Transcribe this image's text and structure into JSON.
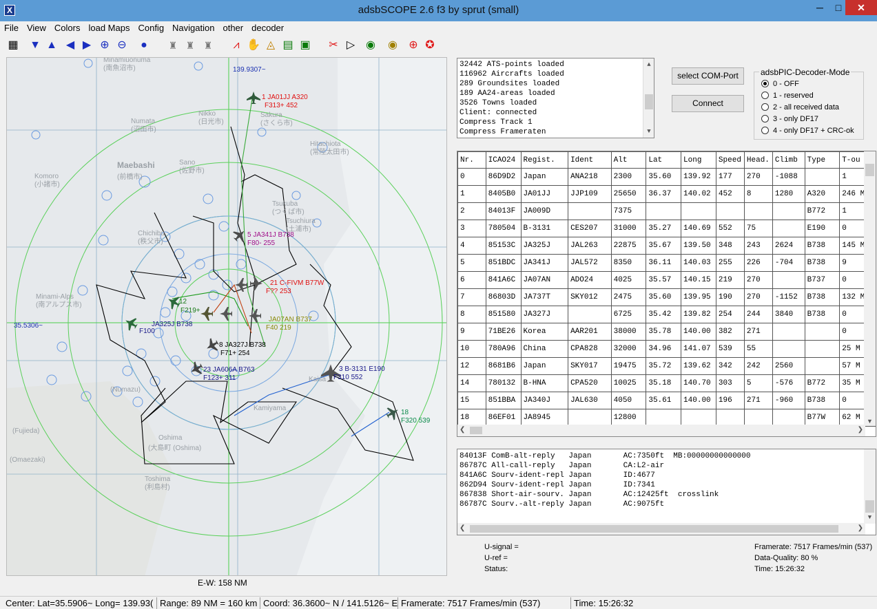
{
  "window": {
    "title": "adsbSCOPE 2.6 f3 by sprut  (small)",
    "min": "─",
    "max": "□",
    "close": "✕",
    "app_icon": "X"
  },
  "menu": [
    "File",
    "View",
    "Colors",
    "load Maps",
    "Config",
    "Navigation",
    "other",
    "decoder"
  ],
  "toolbar_icons": [
    "table-icon",
    "arrow-down-icon",
    "arrow-up-icon",
    "arrow-left-icon",
    "arrow-right-icon",
    "zoom-in-icon",
    "zoom-out-icon",
    "globe-icon",
    "tower-icon",
    "tower-icon",
    "tower-icon",
    "graph-icon",
    "hand-icon",
    "radar-icon",
    "map-icon",
    "monitor-icon",
    "tools-icon",
    "play-icon",
    "record-icon",
    "record-icon",
    "target-icon",
    "lifebuoy-icon"
  ],
  "map": {
    "lon_label": "139.9307~",
    "lat_label": "35.5306~",
    "ew_label": "E-W: 158 NM",
    "aircraft": [
      {
        "label1": "1  JA01JJ  A320",
        "label2": "F313+ 452",
        "color": "#e01010"
      },
      {
        "label1": "5  JA341J  B738",
        "label2": "F80- 255",
        "color": "#a0108a"
      },
      {
        "label1": "21  C-FIVM  B77W",
        "label2": "F??  253",
        "color": "#e01010"
      },
      {
        "label1": "12",
        "label2": "F219+",
        "color": "#1a7a1a"
      },
      {
        "label1": "JA325J  B738",
        "label2": "F100",
        "color": "#1a1a8a"
      },
      {
        "label1": "8  JA327J  B738",
        "label2": "F71+ 254",
        "color": "#000000"
      },
      {
        "label1": "23  JA606A  B763",
        "label2": "F123+ 311",
        "color": "#1a1a8a"
      },
      {
        "label1": "3  B-3131  E190",
        "label2": "F310  552",
        "color": "#1a1a8a"
      },
      {
        "label1": "18",
        "label2": "F320  539",
        "color": "#0a8a4a"
      },
      {
        "label1": "JA07AN  B737",
        "label2": "F40  219",
        "color": "#8a8a0a"
      }
    ],
    "places": [
      {
        "en": "Minamiuonuma",
        "jp": "(南魚沼市)"
      },
      {
        "en": "Numata",
        "jp": "(沼田市)"
      },
      {
        "en": "Maebashi",
        "jp": "(前橋市)"
      },
      {
        "en": "Nikko",
        "jp": "(日光市)"
      },
      {
        "en": "Sakura",
        "jp": "(さくら市)"
      },
      {
        "en": "Hitachiota",
        "jp": "(常陸太田市)"
      },
      {
        "en": "Komoro",
        "jp": "(小諸市)"
      },
      {
        "en": "Sano",
        "jp": "(佐野市)"
      },
      {
        "en": "Tsukuba",
        "jp": "(つくば市)"
      },
      {
        "en": "Chichibu",
        "jp": "(秩父市)"
      },
      {
        "en": "Tsuchiura",
        "jp": "(土浦市)"
      },
      {
        "en": "Minami-Alps",
        "jp": "(南アルプス市)"
      },
      {
        "en": "Numazu",
        "jp": "(Numazu)"
      },
      {
        "en": "Fujieda",
        "jp": "(Fujieda)"
      },
      {
        "en": "Omaezaki",
        "jp": "(Omaezaki)"
      },
      {
        "en": "Oshima",
        "jp": "(大島町 (Oshima)"
      },
      {
        "en": "Toshima",
        "jp": "(利島村)"
      },
      {
        "en": "Kaisa",
        "jp": ""
      },
      {
        "en": "Kamiyama",
        "jp": ""
      }
    ]
  },
  "log": {
    "lines": [
      "32442 ATS-points loaded",
      "116962 Aircrafts loaded",
      "289 Groundsites loaded",
      "189 AA24-areas loaded",
      "3526 Towns loaded",
      "Client: connected",
      "Compress Track 1",
      "Compress Frameraten"
    ]
  },
  "buttons": {
    "com_port": "select COM-Port",
    "connect": "Connect"
  },
  "decoder_mode": {
    "title": "adsbPIC-Decoder-Mode",
    "options": [
      "0 - OFF",
      "1 - reserved",
      "2 - all received data",
      "3 - only DF17",
      "4 - only DF17 + CRC-ok"
    ],
    "selected": 0
  },
  "table": {
    "columns": [
      "Nr.",
      "ICAO24",
      "Regist.",
      "Ident",
      "Alt",
      "Lat",
      "Long",
      "Speed",
      "Head.",
      "Climb",
      "Type",
      "T-ou"
    ],
    "rows": [
      [
        "0",
        "86D9D2",
        "Japan",
        "ANA218",
        "2300",
        "35.60",
        "139.92",
        "177",
        "270",
        "-1088",
        "",
        "1"
      ],
      [
        "1",
        "8405B0",
        "JA01JJ",
        "JJP109",
        "25650",
        "36.37",
        "140.02",
        "452",
        "8",
        "1280",
        "A320",
        "246 M"
      ],
      [
        "2",
        "84013F",
        "JA009D",
        "",
        "7375",
        "",
        "",
        "",
        "",
        "",
        "B772",
        "1"
      ],
      [
        "3",
        "780504",
        "B-3131",
        "CES207",
        "31000",
        "35.27",
        "140.69",
        "552",
        "75",
        "",
        "E190",
        "0"
      ],
      [
        "4",
        "85153C",
        "JA325J",
        "JAL263",
        "22875",
        "35.67",
        "139.50",
        "348",
        "243",
        "2624",
        "B738",
        "145 M"
      ],
      [
        "5",
        "851BDC",
        "JA341J",
        "JAL572",
        "8350",
        "36.11",
        "140.03",
        "255",
        "226",
        "-704",
        "B738",
        "9"
      ],
      [
        "6",
        "841A6C",
        "JA07AN",
        "ADO24",
        "4025",
        "35.57",
        "140.15",
        "219",
        "270",
        "",
        "B737",
        "0"
      ],
      [
        "7",
        "86803D",
        "JA737T",
        "SKY012",
        "2475",
        "35.60",
        "139.95",
        "190",
        "270",
        "-1152",
        "B738",
        "132 M"
      ],
      [
        "8",
        "851580",
        "JA327J",
        "",
        "6725",
        "35.42",
        "139.82",
        "254",
        "244",
        "3840",
        "B738",
        "0"
      ],
      [
        "9",
        "71BE26",
        "Korea",
        "AAR201",
        "38000",
        "35.78",
        "140.00",
        "382",
        "271",
        "",
        "",
        "0"
      ],
      [
        "10",
        "780A96",
        "China",
        "CPA828",
        "32000",
        "34.96",
        "141.07",
        "539",
        "55",
        "",
        "",
        "25 M"
      ],
      [
        "12",
        "8681B6",
        "Japan",
        "SKY017",
        "19475",
        "35.72",
        "139.62",
        "342",
        "242",
        "2560",
        "",
        "57 M"
      ],
      [
        "14",
        "780132",
        "B-HNA",
        "CPA520",
        "10025",
        "35.18",
        "140.70",
        "303",
        "5",
        "-576",
        "B772",
        "35 M"
      ],
      [
        "15",
        "851BBA",
        "JA340J",
        "JAL630",
        "4050",
        "35.61",
        "140.00",
        "196",
        "271",
        "-960",
        "B738",
        "0"
      ],
      [
        "18",
        "86EF01",
        "JA8945",
        "",
        "12800",
        "",
        "",
        "",
        "",
        "",
        "B77W",
        "62 M"
      ]
    ]
  },
  "messages": [
    "84013F ComB-alt-reply   Japan       AC:7350ft  MB:00000000000000",
    "86787C All-call-reply   Japan       CA:L2-air",
    "841A6C Sourv-ident-repl Japan       ID:4677",
    "862D94 Sourv-ident-repl Japan       ID:7341",
    "867838 Short-air-sourv. Japan       AC:12425ft  crosslink",
    "86787C Sourv.-alt-reply Japan       AC:9075ft"
  ],
  "signal": {
    "u_signal": "U-signal =",
    "u_ref": "U-ref =",
    "status": "Status:"
  },
  "stats": {
    "framerate": "Framerate:  7517 Frames/min (537)",
    "quality": "Data-Quality: 80 %",
    "time": "Time: 15:26:32"
  },
  "statusbar": {
    "center": "Center: Lat=35.5906~ Long= 139.93(",
    "range": "Range: 89 NM = 160 km",
    "coord": "Coord: 36.3600~ N / 141.5126~ E",
    "framerate": "Framerate:  7517 Frames/min (537)",
    "time": "Time: 15:26:32"
  }
}
